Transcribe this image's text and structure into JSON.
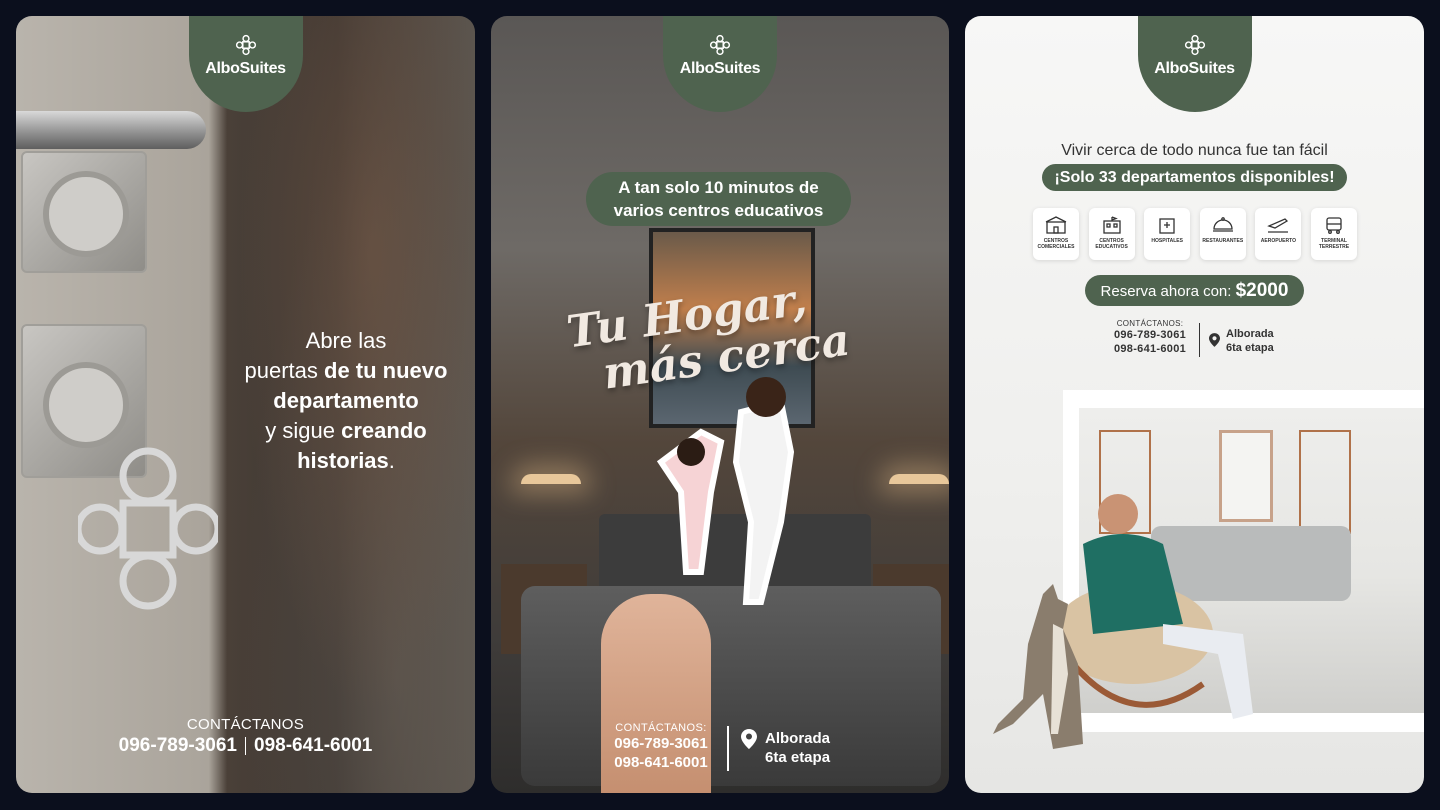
{
  "brand": "AlboSuites",
  "colors": {
    "brand_green": "#4f634f",
    "background": "#0b0f1d"
  },
  "card1": {
    "headline_line1": "Abre las",
    "headline_line2a": "puertas ",
    "headline_line2b": "de tu nuevo",
    "headline_line3": "departamento",
    "headline_line4a": "y sigue ",
    "headline_line4b": "creando",
    "headline_line5a": "historias",
    "headline_line5b": ".",
    "contact_label": "CONTÁCTANOS",
    "phone1": "096-789-3061",
    "phone2": "098-641-6001"
  },
  "card2": {
    "pill_line1": "A tan solo 10 minutos de",
    "pill_line2": "varios centros educativos",
    "script_line1": "Tu Hogar,",
    "script_line2": "más cerca",
    "contact_label": "CONTÁCTANOS:",
    "phone1": "096-789-3061",
    "phone2": "098-641-6001",
    "location_line1": "Alborada",
    "location_line2": "6ta etapa"
  },
  "card3": {
    "tagline": "Vivir cerca de todo nunca fue tan fácil",
    "availability": "¡Solo 33 departamentos disponibles!",
    "amenities": [
      {
        "icon": "shopping-mall-icon",
        "label": "CENTROS COMERCIALES"
      },
      {
        "icon": "school-icon",
        "label": "CENTROS EDUCATIVOS"
      },
      {
        "icon": "hospital-icon",
        "label": "HOSPITALES"
      },
      {
        "icon": "restaurant-icon",
        "label": "RESTAURANTES"
      },
      {
        "icon": "airport-icon",
        "label": "AEROPUERTO"
      },
      {
        "icon": "bus-terminal-icon",
        "label": "TERMINAL TERRESTRE"
      }
    ],
    "reserve_label": "Reserva ahora con: ",
    "reserve_price": "$2000",
    "contact_label": "CONTÁCTANOS:",
    "phone1": "096-789-3061",
    "phone2": "098-641-6001",
    "location_line1": "Alborada",
    "location_line2": "6ta etapa"
  }
}
